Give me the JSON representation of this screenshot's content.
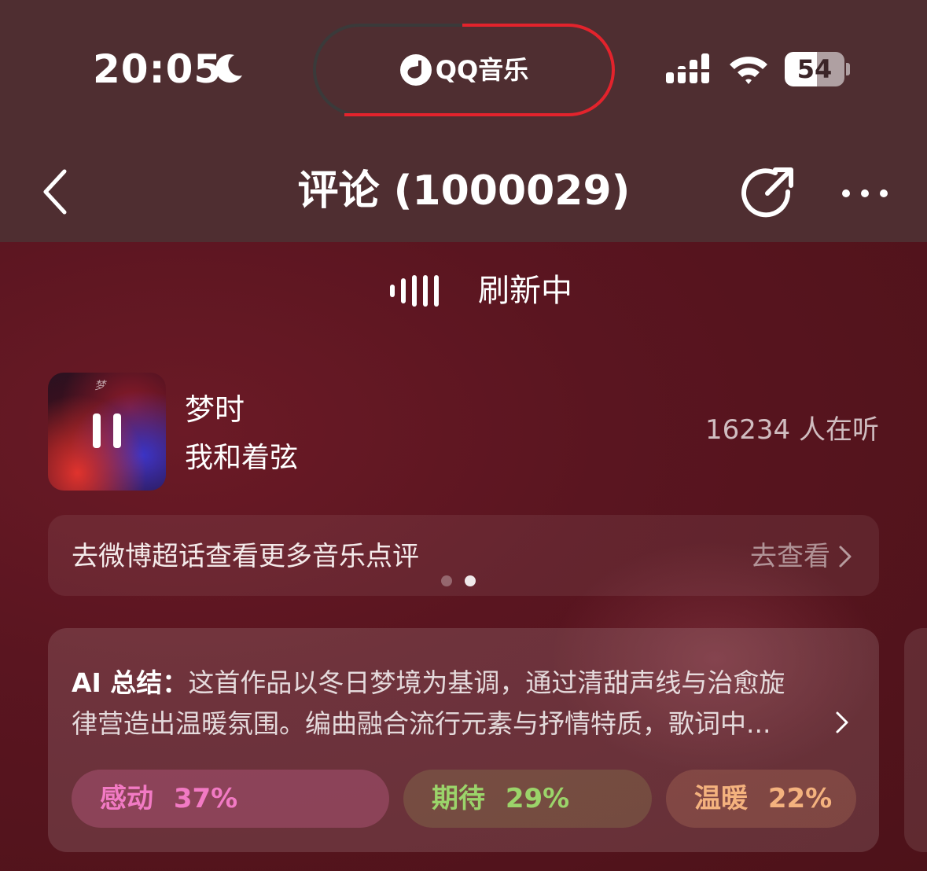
{
  "status_bar": {
    "time": "20:05",
    "island_label": "QQ音乐",
    "battery": "54",
    "battery_level": 0.54,
    "icons": [
      "moon-icon",
      "qq-music-logo-icon",
      "signal-icon",
      "wifi-icon",
      "battery-icon"
    ]
  },
  "nav": {
    "title": "评论 (1000029)",
    "icons": [
      "back-icon",
      "share-icon",
      "more-icon"
    ]
  },
  "refresh": {
    "label": "刷新中"
  },
  "song": {
    "title": "梦时",
    "artist": "我和着弦",
    "art_text": "梦",
    "listeners": "16234 人在听"
  },
  "banner": {
    "text": "去微博超话查看更多音乐点评",
    "action": "去查看",
    "pages": 2,
    "active_page": 2
  },
  "ai_summary": {
    "label": "AI 总结：",
    "line1": "这首作品以冬日梦境为基调，通过清甜声线与治愈旋",
    "line2": "律营造出温暖氛围。编曲融合流行元素与抒情特质，歌词中...",
    "tags": [
      {
        "label": "感动",
        "percent": "37%",
        "color": "#f27ac4"
      },
      {
        "label": "期待",
        "percent": "29%",
        "color": "#9bd46a"
      },
      {
        "label": "温暖",
        "percent": "22%",
        "color": "#f4b27e"
      }
    ]
  }
}
